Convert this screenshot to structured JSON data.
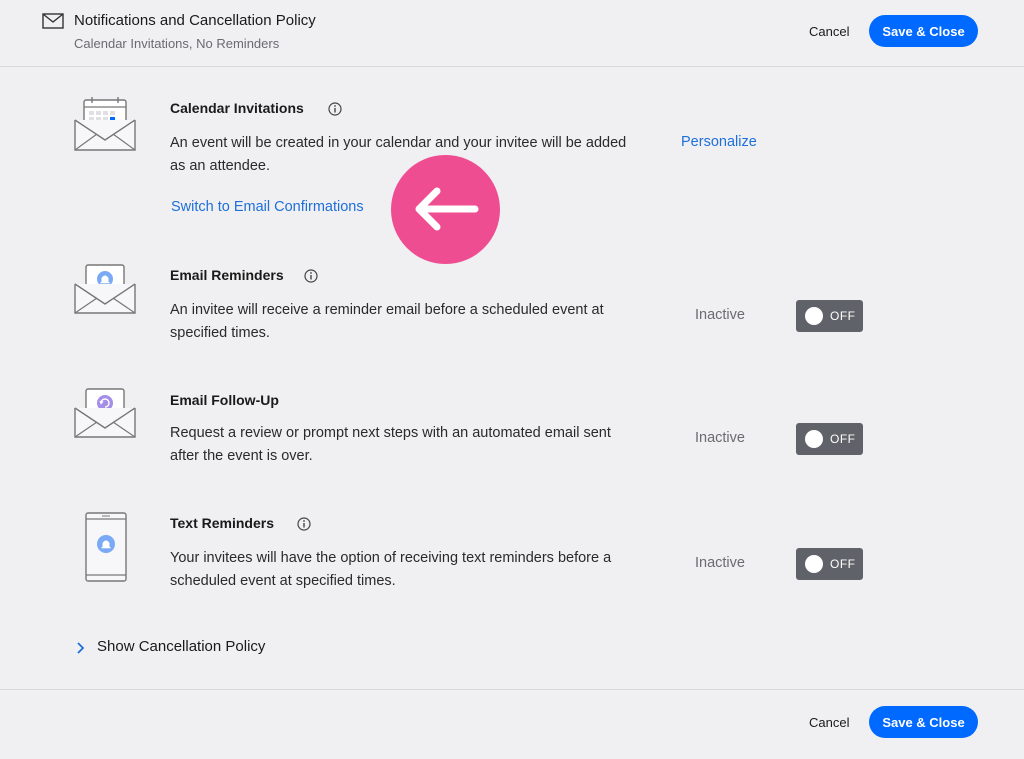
{
  "header": {
    "title": "Notifications and Cancellation Policy",
    "subtitle": "Calendar Invitations, No Reminders",
    "cancel_label": "Cancel",
    "save_label": "Save & Close"
  },
  "calendar_invitations": {
    "title": "Calendar Invitations",
    "description": "An event will be created in your calendar and your invitee will be added as an attendee.",
    "personalize_label": "Personalize",
    "switch_label": "Switch to Email Confirmations"
  },
  "email_reminders": {
    "title": "Email Reminders",
    "description": "An invitee will receive a reminder email before a scheduled event at specified times.",
    "status": "Inactive",
    "toggle_label": "OFF"
  },
  "email_followup": {
    "title": "Email Follow-Up",
    "description": "Request a review or prompt next steps with an automated email sent after the event is over.",
    "status": "Inactive",
    "toggle_label": "OFF"
  },
  "text_reminders": {
    "title": "Text Reminders",
    "description": "Your invitees will have the option of receiving text reminders before a scheduled event at specified times.",
    "status": "Inactive",
    "toggle_label": "OFF"
  },
  "cancellation": {
    "label": "Show Cancellation Policy"
  },
  "footer": {
    "cancel_label": "Cancel",
    "save_label": "Save & Close"
  },
  "colors": {
    "accent": "#0069ff",
    "link": "#1e6fd9",
    "toggle_off": "#5f6268",
    "highlight": "#ef4d91"
  },
  "icons": [
    "mail-icon",
    "info-icon",
    "calendar-envelope-icon",
    "bell-envelope-icon",
    "followup-envelope-icon",
    "phone-bell-icon",
    "arrow-left-icon",
    "chevron-right-icon"
  ]
}
